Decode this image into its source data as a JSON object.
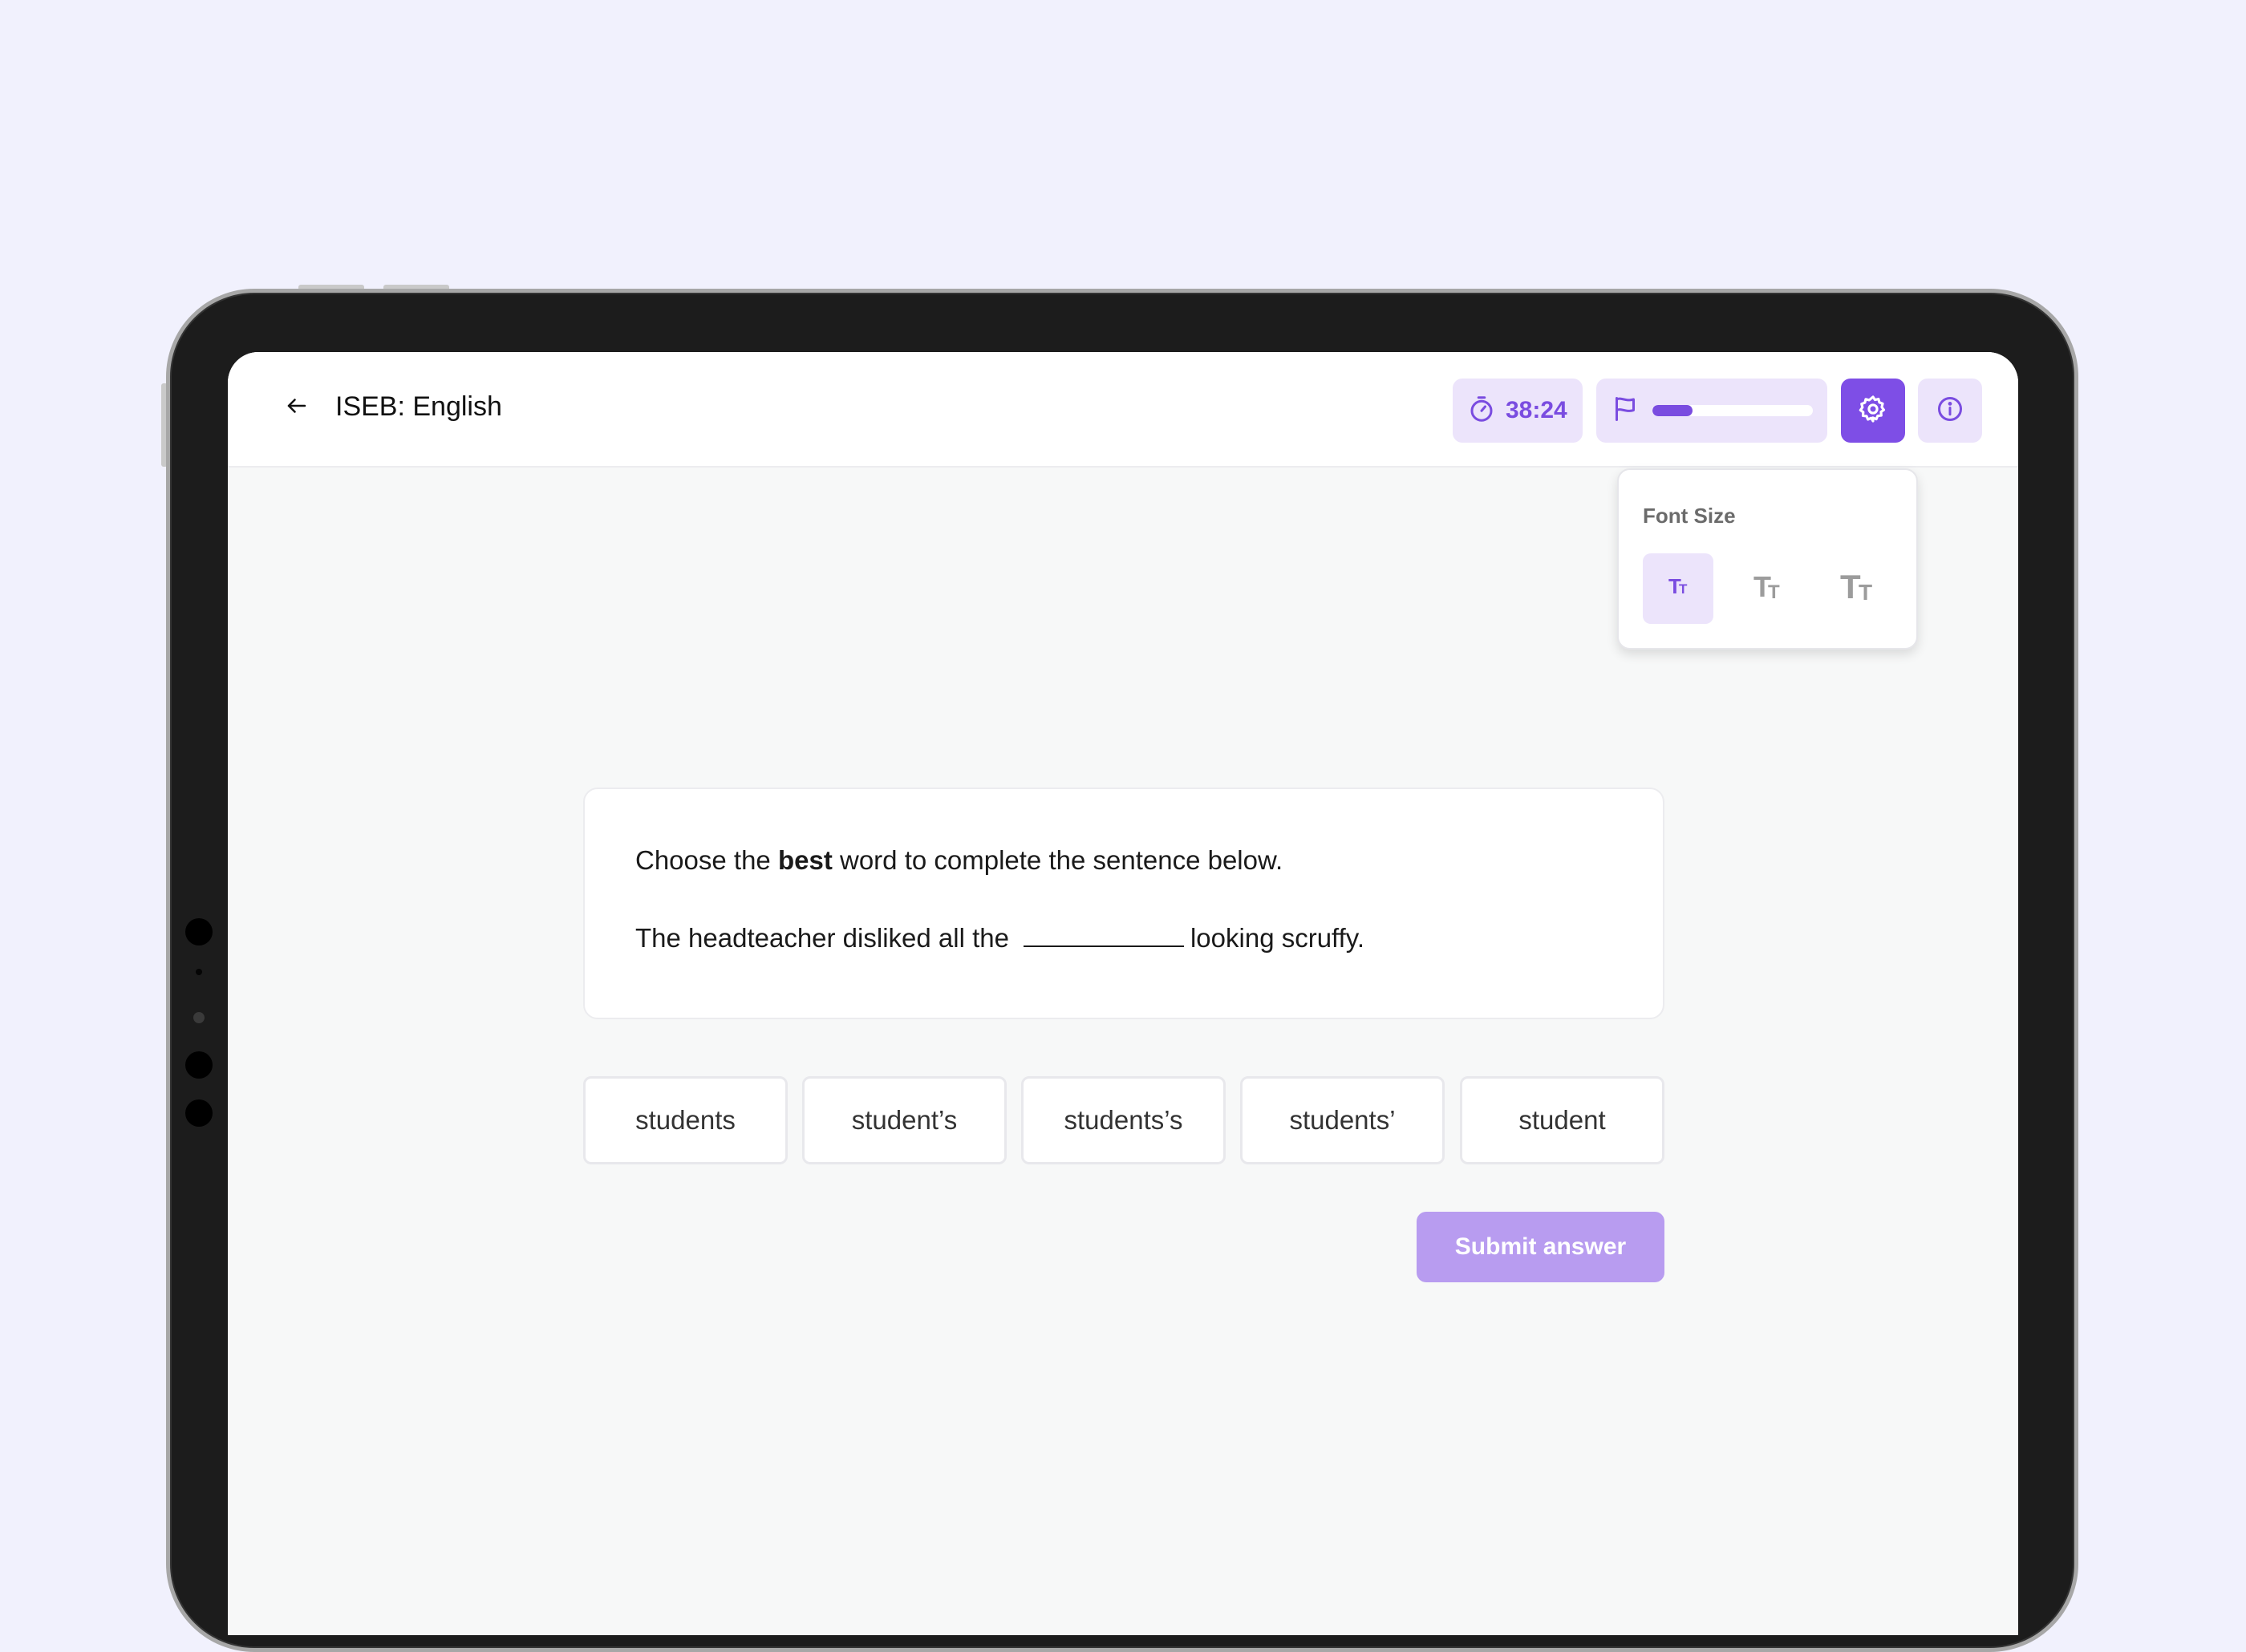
{
  "header": {
    "title": "ISEB: English",
    "timer": "38:24",
    "progress_fraction": 0.25
  },
  "font_size_panel": {
    "title": "Font Size",
    "options": [
      "Tт",
      "Tт",
      "Tт"
    ],
    "selected_index": 0
  },
  "question": {
    "instruction_prefix": "Choose the",
    "instruction_bold": "best",
    "instruction_suffix": "word to complete the sentence below.",
    "sentence_before": "The headteacher disliked all the",
    "sentence_after": "looking scruffy."
  },
  "answers": [
    "students",
    "student’s",
    "students’s",
    "students’",
    "student"
  ],
  "submit_label": "Submit answer",
  "colors": {
    "accent": "#7e4ee6",
    "accent_light": "#ece4fb",
    "submit_disabled": "#b89cf0",
    "background": "#f1f1fd"
  }
}
